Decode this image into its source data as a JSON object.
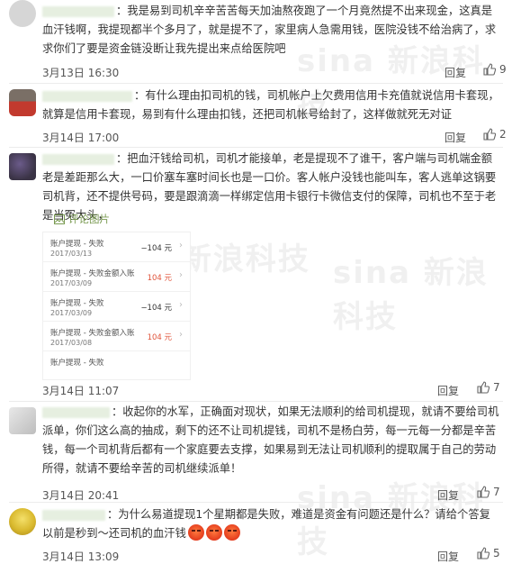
{
  "comments": [
    {
      "text": "：我是易到司机辛辛苦苦每天加油熬夜跑了一个月竟然提不出来现金，这真是血汗钱啊，我提现都半个多月了，就是提不了，家里病人急需用钱，医院没钱不给治病了，求求你们了要是资金链没断让我先提出来点给医院吧",
      "time": "3月13日 16:30",
      "reply": "回复",
      "likes": "9"
    },
    {
      "text": "：有什么理由扣司机的钱，司机帐户上欠费用信用卡充值就说信用卡套现，就算是信用卡套现，易到有什么理由扣钱，还把司机帐号给封了，这样做就死无对证",
      "time": "3月14日 17:00",
      "reply": "回复",
      "likes": "2"
    },
    {
      "text": "：把血汗钱给司机，司机才能接单，老是提现不了谁干，客户端与司机端金额老是差距那么大，一口价塞车塞时间长也是一口价。客人帐户没钱也能叫车，客人逃单这锅要司机背，还不提供号码，要是跟滴滴一样绑定信用卡银行卡微信支付的保障，司机也不至于老是当冤大头，",
      "thread": "评论图片",
      "time": "3月14日 11:07",
      "reply": "回复",
      "likes": "7"
    },
    {
      "text": "：收起你的水军，正确面对现状，如果无法顺利的给司机提现，就请不要给司机派单，你们这么高的抽成，剩下的还不让司机提钱，司机不是杨白劳，每一元每一分都是辛苦钱，每一个司机背后都有一个家庭要去支撑，如果易到无法让司机顺利的提取属于自己的劳动所得，就请不要给辛苦的司机继续派单！",
      "time": "3月14日 20:41",
      "reply": "回复",
      "likes": "7"
    },
    {
      "text": "：为什么易道提现1个星期都是失败，难道是资金有问题还是什么？请给个答复以前是秒到～还司机的血汗钱",
      "time": "3月14日 13:09",
      "reply": "回复",
      "likes": "5"
    }
  ],
  "screenshot_rows": [
    {
      "title": "账户提现 - 失败",
      "date": "2017/03/13",
      "amount": "−104 元",
      "color": "#333333"
    },
    {
      "title": "账户提现 - 失败金额入账",
      "date": "2017/03/09",
      "amount": "104 元",
      "color": "#e0533a"
    },
    {
      "title": "账户提现 - 失败",
      "date": "2017/03/09",
      "amount": "−104 元",
      "color": "#333333"
    },
    {
      "title": "账户提现 - 失败金额入账",
      "date": "2017/03/08",
      "amount": "104 元",
      "color": "#e0533a"
    },
    {
      "title": "账户提现 - 失败",
      "date": "2017/03/08",
      "amount": "",
      "color": "#333333"
    }
  ],
  "watermark": "sina 新浪科技",
  "colors": {
    "accent": "#e0533a",
    "thread": "#7a9b52"
  }
}
